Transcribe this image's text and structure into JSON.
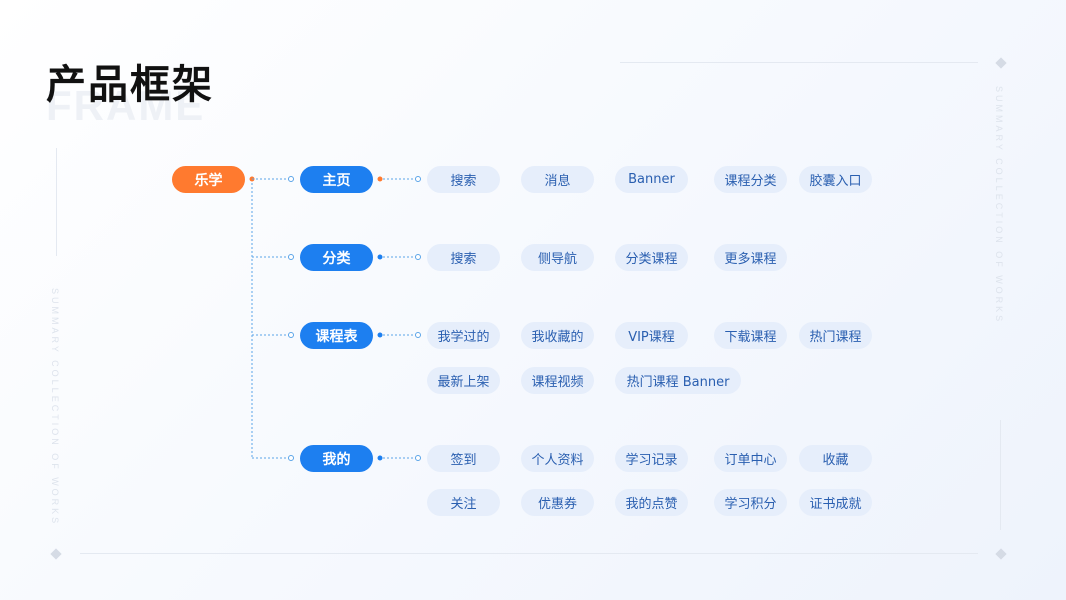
{
  "header": {
    "title": "产品框架",
    "title_bg": "FRAME"
  },
  "decoration": {
    "vertical_text": "SUMMARY COLLECTION OF WORKS"
  },
  "root": {
    "label": "乐学"
  },
  "categories": [
    {
      "label": "主页",
      "items": [
        "搜索",
        "消息",
        "Banner",
        "课程分类",
        "胶囊入口"
      ]
    },
    {
      "label": "分类",
      "items": [
        "搜索",
        "侧导航",
        "分类课程",
        "更多课程"
      ]
    },
    {
      "label": "课程表",
      "items": [
        "我学过的",
        "我收藏的",
        "VIP课程",
        "下载课程",
        "热门课程",
        "最新上架",
        "课程视频",
        "热门课程 Banner"
      ]
    },
    {
      "label": "我的",
      "items": [
        "签到",
        "个人资料",
        "学习记录",
        "订单中心",
        "收藏",
        "关注",
        "优惠券",
        "我的点赞",
        "学习积分",
        "证书成就"
      ]
    }
  ],
  "colors": {
    "root": "#ff7a2f",
    "category": "#1d7ff0",
    "leaf_bg": "#e6eefb",
    "leaf_text": "#2a5fb0",
    "connector": "#5aa4e8"
  }
}
